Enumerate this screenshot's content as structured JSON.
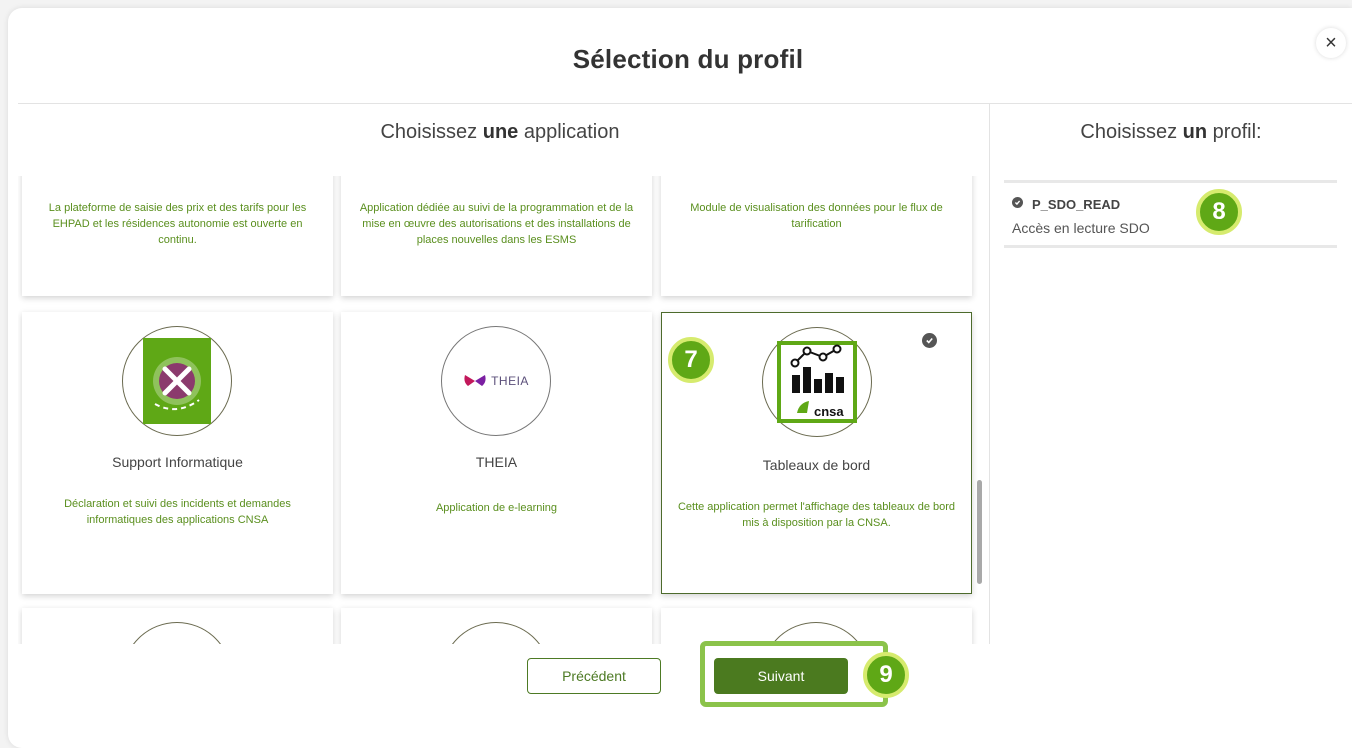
{
  "modal": {
    "title": "Sélection du profil",
    "close_label": "×"
  },
  "apps_section": {
    "title_prefix": "Choisissez ",
    "title_bold": "une",
    "title_suffix": " application"
  },
  "profile_section": {
    "title_prefix": "Choisissez ",
    "title_bold": "un",
    "title_suffix": " profil:"
  },
  "apps": [
    {
      "name": "",
      "description": "La plateforme de saisie des prix et des tarifs pour les EHPAD et les résidences autonomie est ouverte en continu.",
      "selected": false
    },
    {
      "name": "",
      "description": "Application dédiée au suivi de la programmation et de la mise en œuvre des autorisations et des installations de places nouvelles dans les ESMS",
      "selected": false
    },
    {
      "name": "",
      "description": "Module de visualisation des données pour le flux de tarification",
      "selected": false
    },
    {
      "name": "Support Informatique",
      "description": "Déclaration et suivi des incidents et demandes informatiques des applications CNSA",
      "selected": false,
      "logo": "wrench-screwdriver-icon"
    },
    {
      "name": "THEIA",
      "description": "Application de e-learning",
      "selected": false,
      "logo": "theia-logo",
      "logo_text": "THEIA"
    },
    {
      "name": "Tableaux de bord",
      "description": "Cette application permet l'affichage des tableaux de bord mis à disposition par la CNSA.",
      "selected": true,
      "logo": "dashboard-chart-icon",
      "logo_text": "cnsa"
    }
  ],
  "profiles": [
    {
      "code": "P_SDO_READ",
      "description": "Accès en lecture SDO",
      "selected": true
    }
  ],
  "badges": {
    "card": "7",
    "profile": "8",
    "next": "9"
  },
  "buttons": {
    "previous": "Précédent",
    "next": "Suivant"
  },
  "colors": {
    "accent_green": "#4b7a1f",
    "description_green": "#5a8f1e",
    "badge_green": "#5fa816",
    "highlight_green": "#8bc34a"
  }
}
